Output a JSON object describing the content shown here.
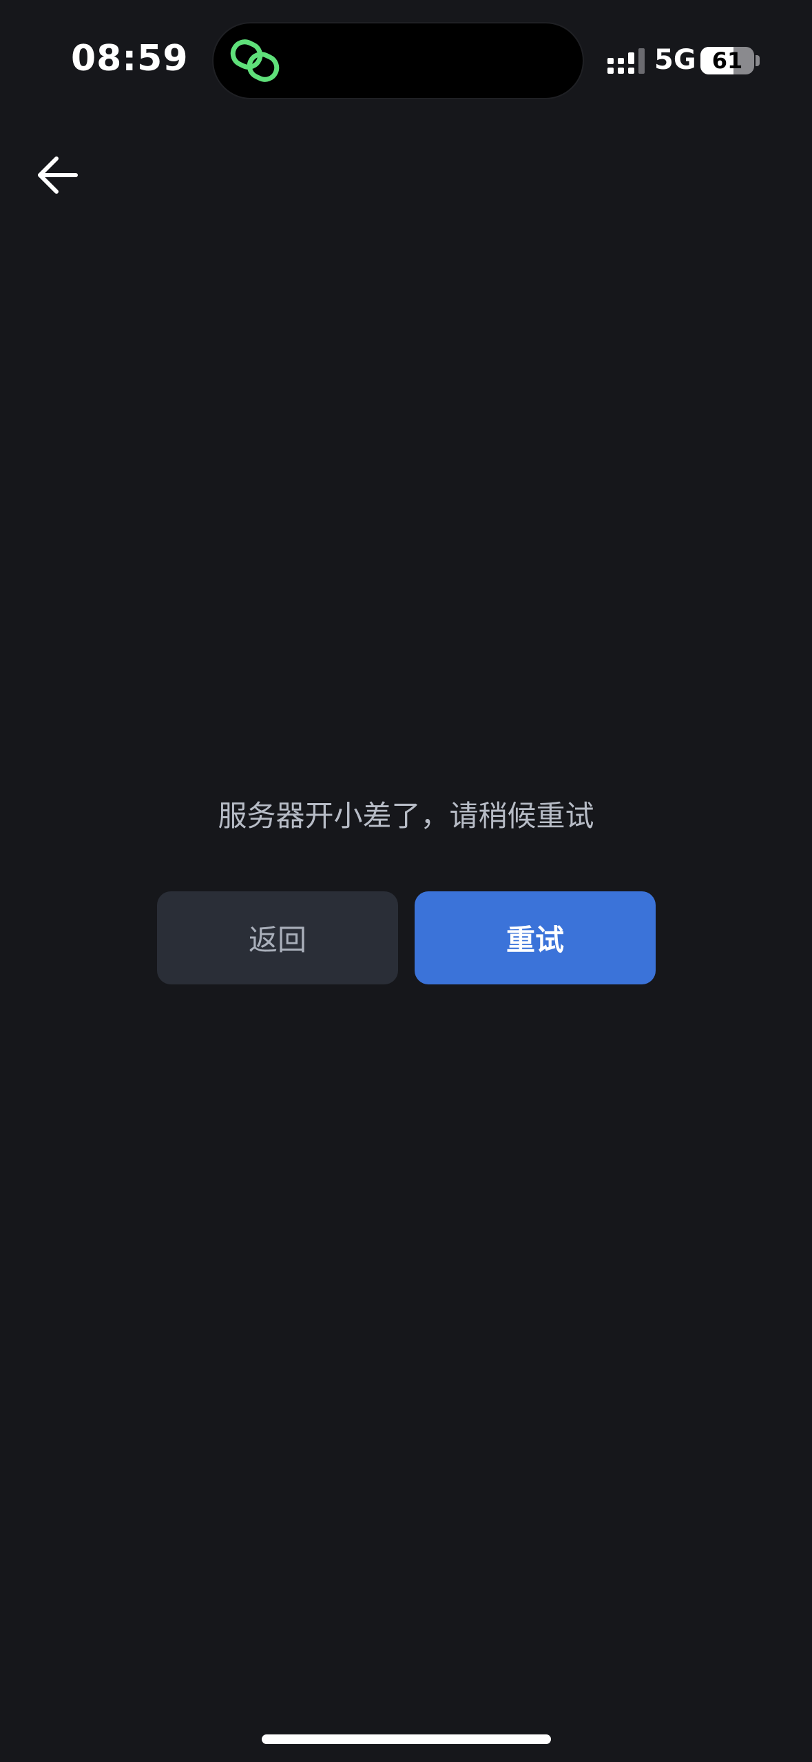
{
  "status_bar": {
    "time": "08:59",
    "network": "5G",
    "battery_level": "61",
    "battery_fraction": 0.61,
    "island_icon": "link-icon",
    "signal_icon": "signal-bars-icon"
  },
  "nav": {
    "back_icon": "arrow-left-icon"
  },
  "error": {
    "message": "服务器开小差了，请稍候重试"
  },
  "actions": {
    "back_label": "返回",
    "retry_label": "重试"
  },
  "colors": {
    "background": "#16171b",
    "primary": "#3b73d9",
    "secondary_button": "#2a2e37",
    "island_accent": "#5fe07a"
  }
}
